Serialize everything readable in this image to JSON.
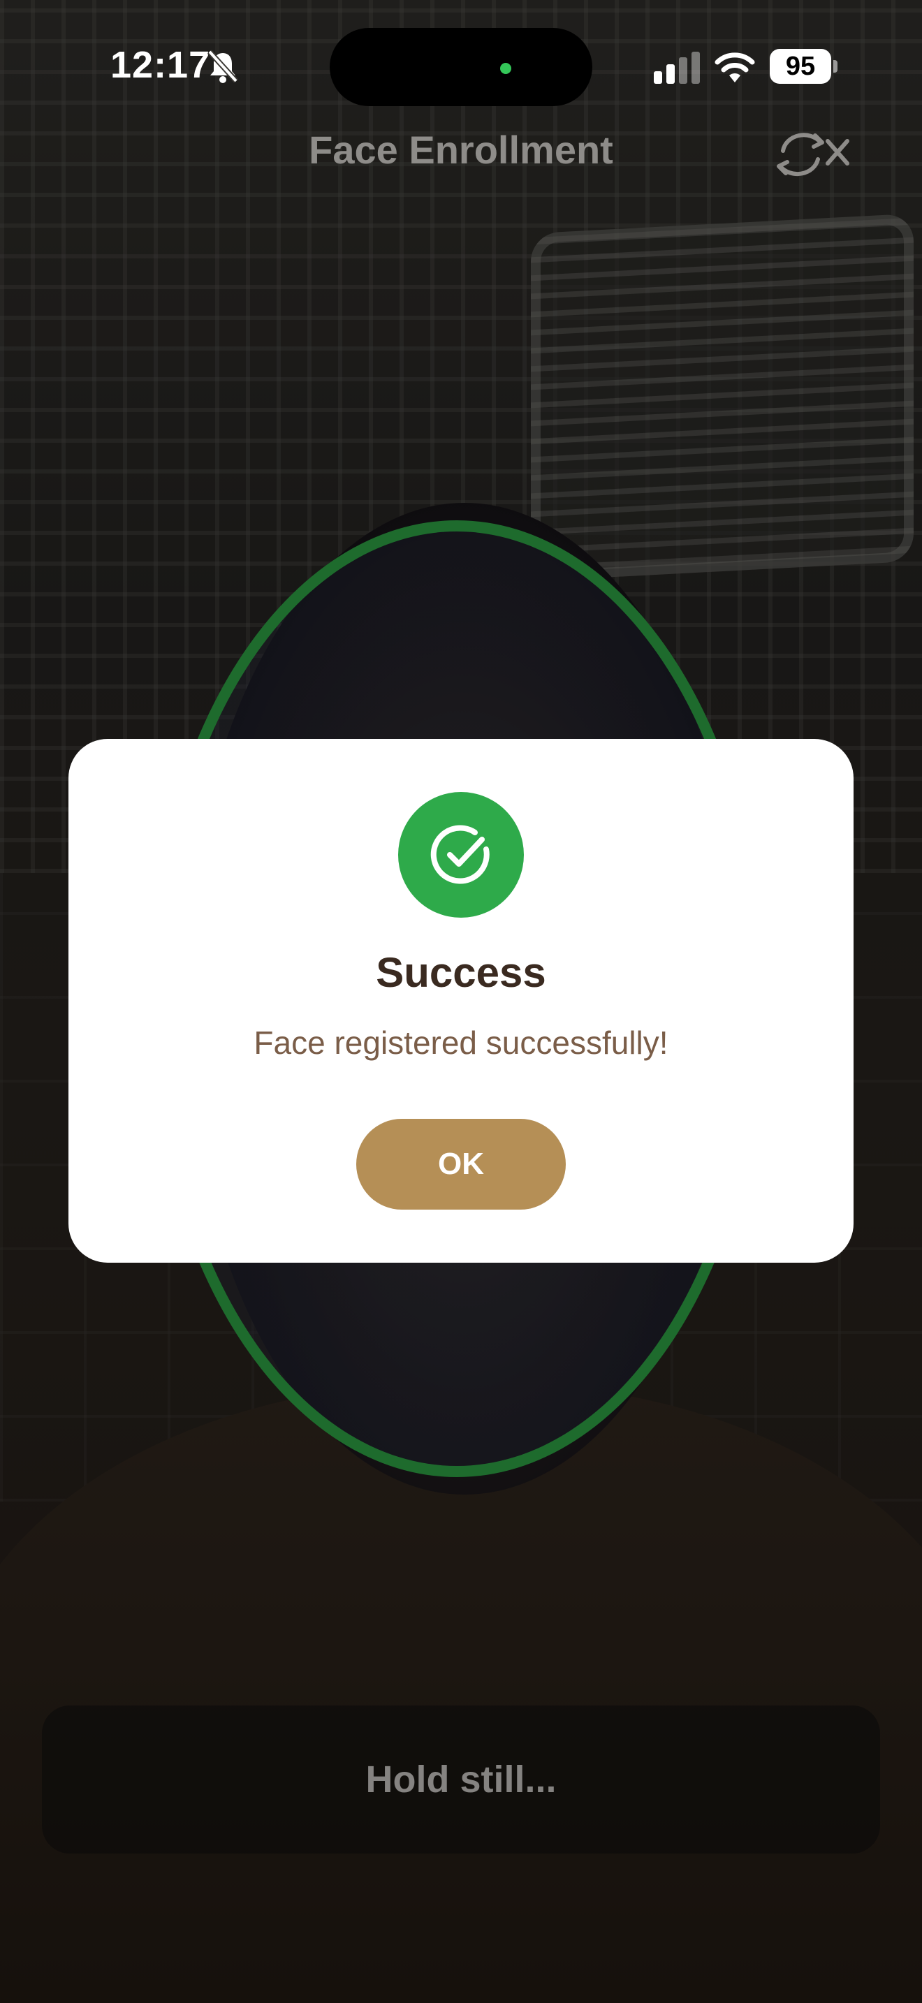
{
  "status_bar": {
    "time": "12:17",
    "battery": "95",
    "icons": [
      "bell-slash-icon",
      "signal-icon",
      "wifi-icon",
      "battery-icon"
    ]
  },
  "header": {
    "title": "Face Enrollment",
    "switch_camera_icon": "camera-switch-off-icon"
  },
  "dialog": {
    "icon": "check-circle-icon",
    "title": "Success",
    "message": "Face registered successfully!",
    "ok_label": "OK"
  },
  "instruction": {
    "text": "Hold still..."
  },
  "colors": {
    "success_green": "#2eaa4a",
    "oval_green": "#1e6b2d",
    "button_gold": "#b58f56",
    "title_brown": "#3a2a20",
    "message_brown": "#7a5d48"
  }
}
